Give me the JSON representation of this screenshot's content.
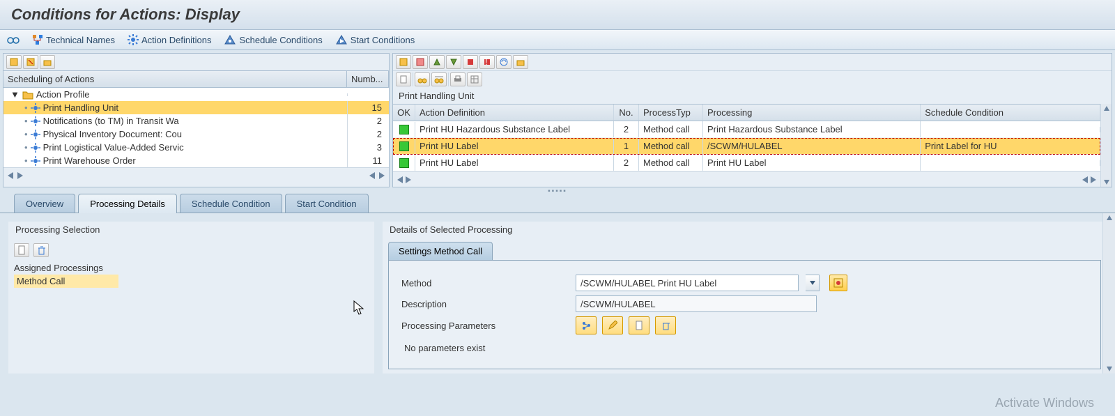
{
  "title": "Conditions for Actions: Display",
  "toolbar": {
    "technical_names": "Technical Names",
    "action_definitions": "Action Definitions",
    "schedule_conditions": "Schedule Conditions",
    "start_conditions": "Start Conditions"
  },
  "left": {
    "header_col1": "Scheduling of Actions",
    "header_col2": "Numb...",
    "root": "Action Profile",
    "items": [
      {
        "label": "Print Handling Unit",
        "num": "15",
        "selected": true
      },
      {
        "label": "Notifications (to TM) in Transit Wa",
        "num": "2"
      },
      {
        "label": "Physical Inventory Document: Cou",
        "num": "2"
      },
      {
        "label": "Print Logistical Value-Added Servic",
        "num": "3"
      },
      {
        "label": "Print Warehouse Order",
        "num": "11"
      }
    ]
  },
  "right": {
    "subtitle": "Print Handling Unit",
    "cols": {
      "ok": "OK",
      "def": "Action Definition",
      "no": "No.",
      "ptyp": "ProcessTyp",
      "proc": "Processing",
      "sched": "Schedule Condition"
    },
    "rows": [
      {
        "def": "Print HU Hazardous Substance Label",
        "no": "2",
        "ptyp": "Method call",
        "proc": "Print Hazardous Substance Label",
        "sched": ""
      },
      {
        "def": "Print HU Label",
        "no": "1",
        "ptyp": "Method call",
        "proc": "/SCWM/HULABEL",
        "sched": "Print Label for HU",
        "selected": true
      },
      {
        "def": "Print HU Label",
        "no": "2",
        "ptyp": "Method call",
        "proc": "Print HU Label",
        "sched": ""
      }
    ]
  },
  "tabs": {
    "overview": "Overview",
    "processing": "Processing Details",
    "schedule": "Schedule Condition",
    "start": "Start Condition"
  },
  "proc_sel": {
    "title": "Processing Selection",
    "assigned": "Assigned Processings",
    "row": "Method Call"
  },
  "details": {
    "title": "Details of Selected Processing",
    "tab": "Settings Method Call",
    "method_lbl": "Method",
    "method_val": "/SCWM/HULABEL Print HU Label",
    "desc_lbl": "Description",
    "desc_val": "/SCWM/HULABEL",
    "params_lbl": "Processing Parameters",
    "params_none": "No parameters exist"
  },
  "watermark": "Activate Windows"
}
